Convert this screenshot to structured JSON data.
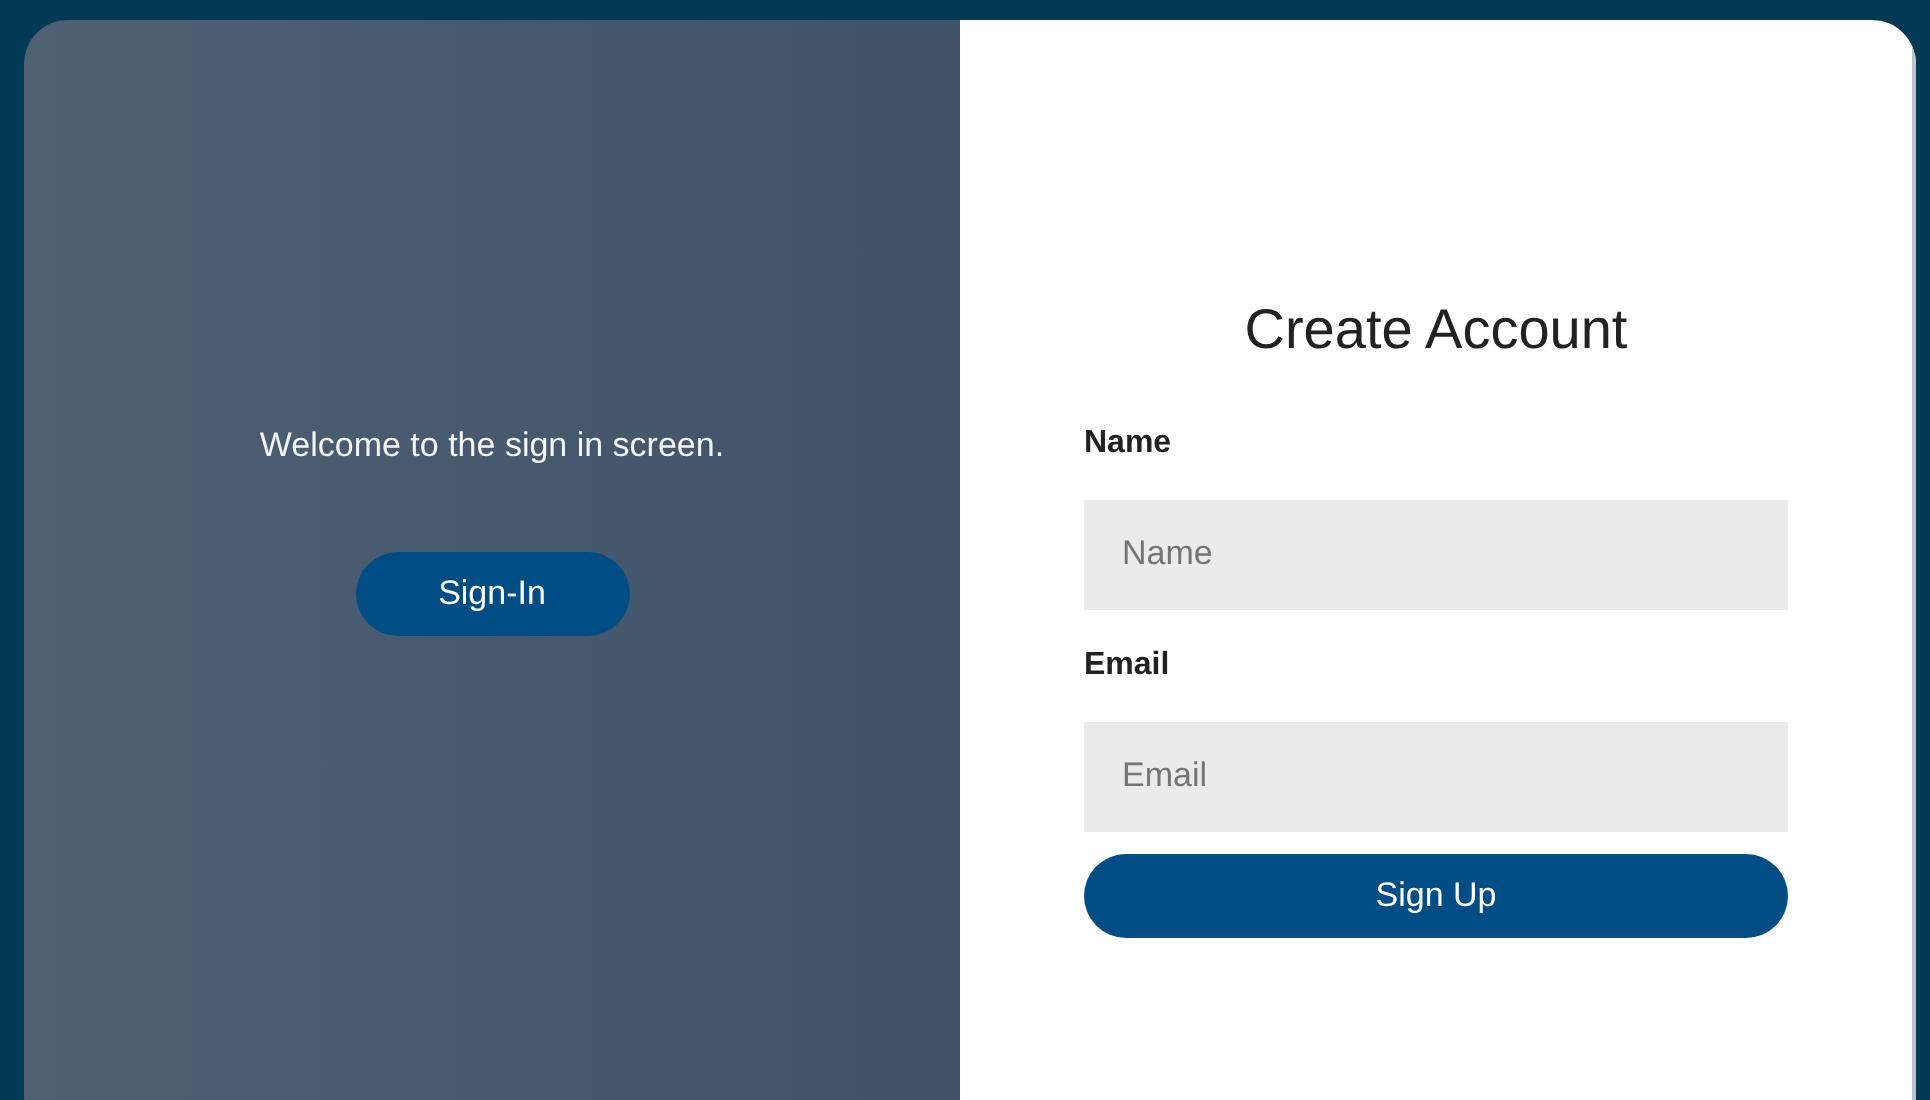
{
  "welcome_panel": {
    "message": "Welcome to the sign in screen.",
    "button": "Sign-In"
  },
  "signup_form": {
    "title": "Create Account",
    "fields": [
      {
        "label": "Name",
        "placeholder": "Name"
      },
      {
        "label": "Email",
        "placeholder": "Email"
      }
    ],
    "button": "Sign Up"
  }
}
